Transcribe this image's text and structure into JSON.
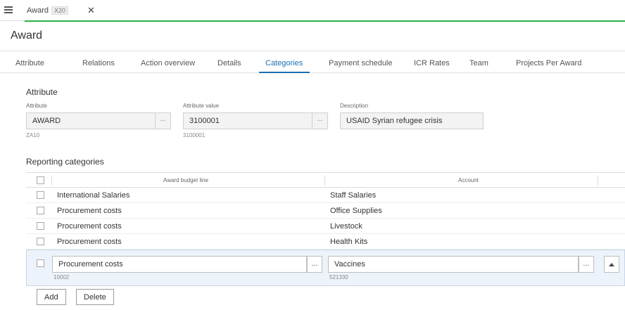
{
  "header": {
    "doc_tab_name": "Award",
    "doc_tab_badge": "X20",
    "close_glyph": "✕"
  },
  "page_title": "Award",
  "tabs": [
    {
      "label": "Attribute"
    },
    {
      "label": "Relations"
    },
    {
      "label": "Action overview"
    },
    {
      "label": "Details"
    },
    {
      "label": "Categories",
      "active": true
    },
    {
      "label": "Payment schedule"
    },
    {
      "label": "ICR Rates"
    },
    {
      "label": "Team"
    },
    {
      "label": "Projects Per Award"
    }
  ],
  "attribute_section": {
    "title": "Attribute",
    "attribute": {
      "label": "Attribute",
      "value": "AWARD",
      "sub": "ZA10"
    },
    "attribute_value": {
      "label": "Attribute value",
      "value": "3100001",
      "sub": "3100001"
    },
    "description": {
      "label": "Description",
      "value": "USAID Syrian refugee crisis"
    },
    "lookup_glyph": "..."
  },
  "reporting": {
    "title": "Reporting categories",
    "columns": {
      "budget_line": "Award budget line",
      "account": "Account"
    },
    "rows": [
      {
        "budget_line": "International Salaries",
        "account": "Staff Salaries"
      },
      {
        "budget_line": "Procurement costs",
        "account": "Office Supplies"
      },
      {
        "budget_line": "Procurement costs",
        "account": "Livestock"
      },
      {
        "budget_line": "Procurement costs",
        "account": "Health Kits"
      }
    ],
    "edit_row": {
      "budget_line": "Procurement costs",
      "budget_line_sub": "10002",
      "account": "Vaccines",
      "account_sub": "521330",
      "lookup_glyph": "..."
    }
  },
  "buttons": {
    "add": "Add",
    "delete": "Delete"
  },
  "colors": {
    "accent": "#1a6fb3",
    "tab_underline": "#2bb04a",
    "edit_row_bg": "#edf3fa"
  }
}
